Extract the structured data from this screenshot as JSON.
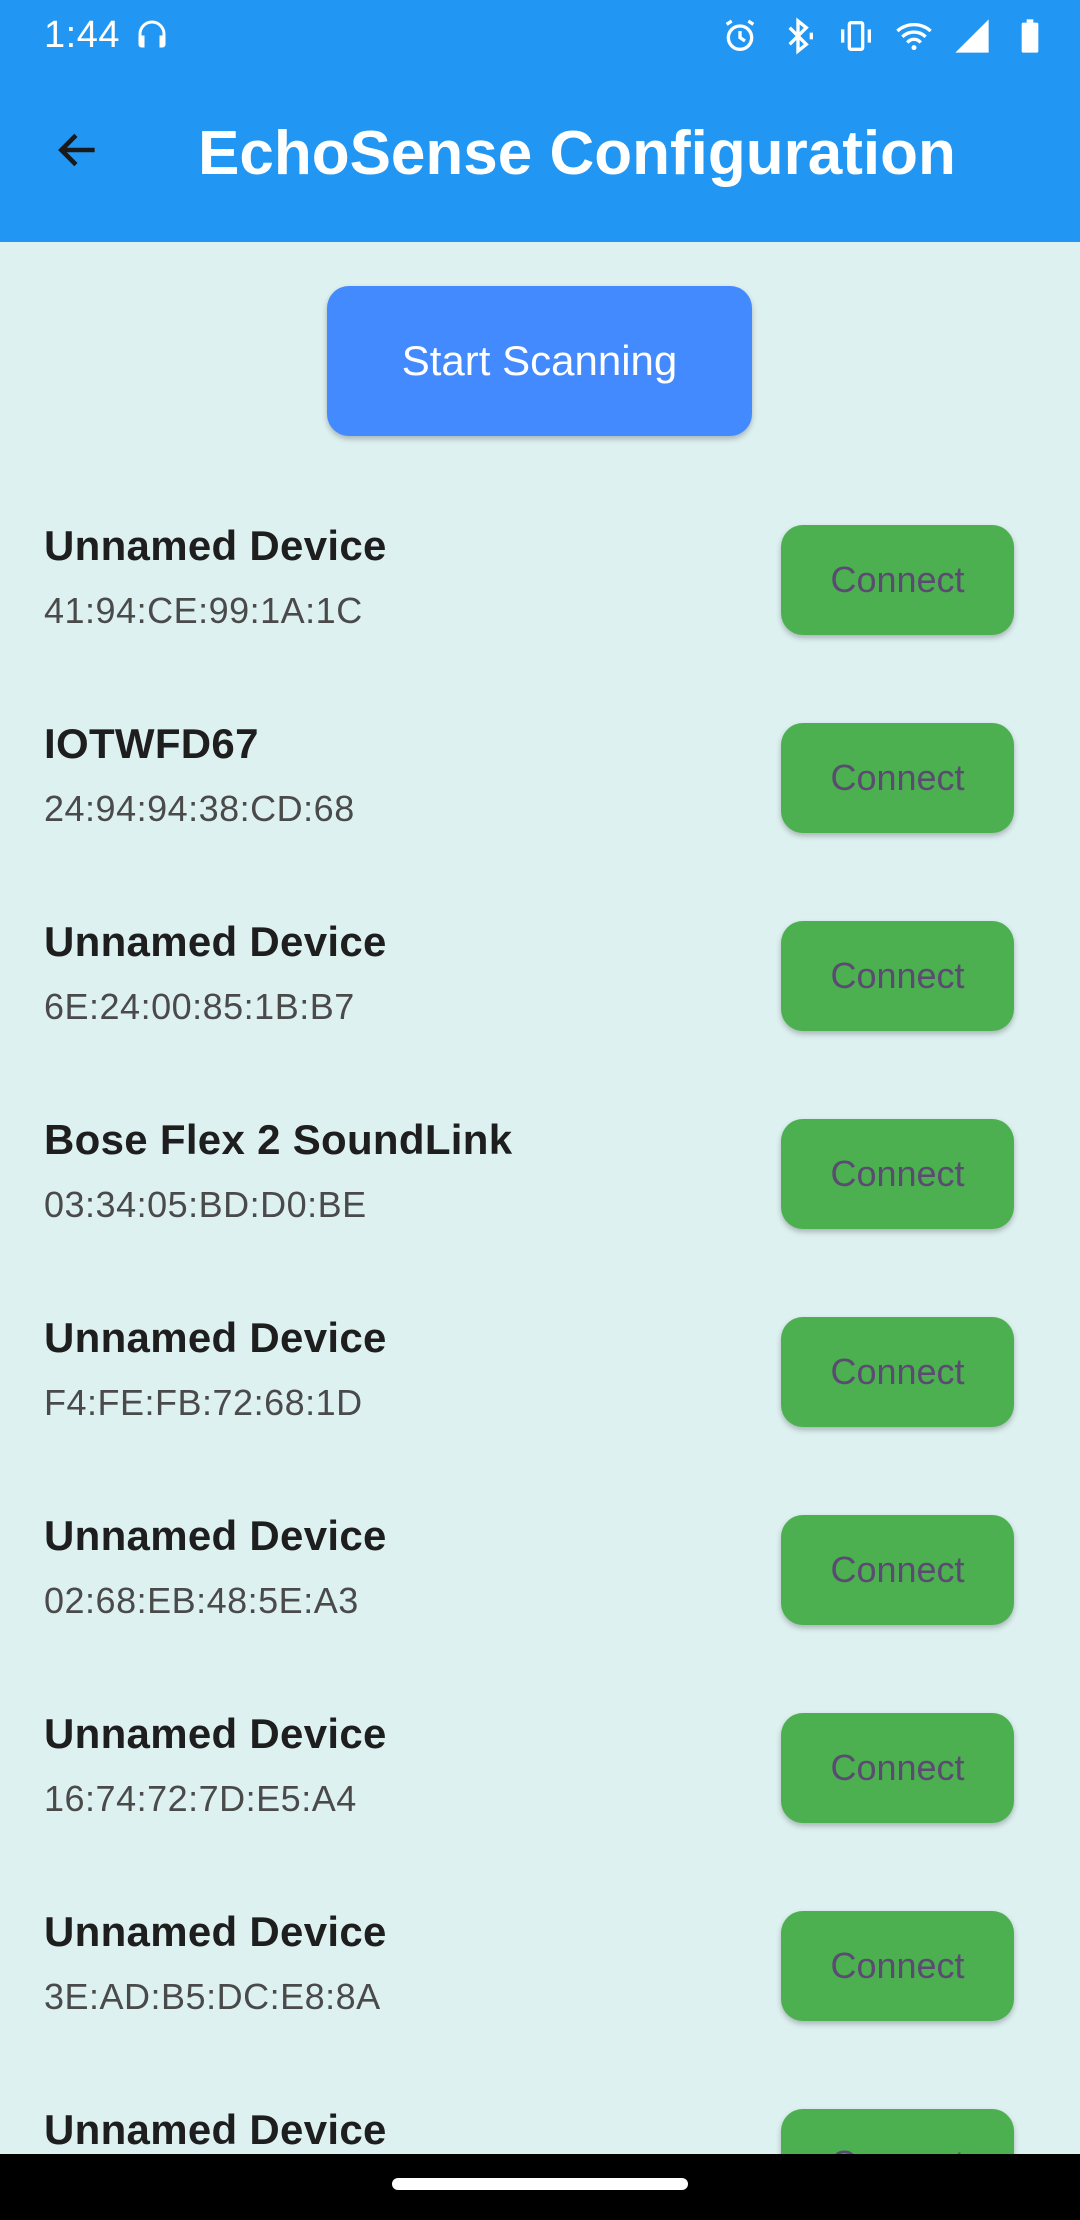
{
  "status_bar": {
    "time": "1:44",
    "icons": [
      "headphones-icon",
      "alarm-icon",
      "bluetooth-icon",
      "vibrate-icon",
      "wifi-icon",
      "signal-icon",
      "battery-icon"
    ]
  },
  "app_bar": {
    "title": "EchoSense Configuration",
    "back_icon": "arrow-back-icon"
  },
  "scan_button": {
    "label": "Start Scanning"
  },
  "devices": [
    {
      "name": "Unnamed Device",
      "mac": "41:94:CE:99:1A:1C",
      "action": "Connect"
    },
    {
      "name": "IOTWFD67",
      "mac": "24:94:94:38:CD:68",
      "action": "Connect"
    },
    {
      "name": "Unnamed Device",
      "mac": "6E:24:00:85:1B:B7",
      "action": "Connect"
    },
    {
      "name": "Bose Flex 2 SoundLink",
      "mac": "03:34:05:BD:D0:BE",
      "action": "Connect"
    },
    {
      "name": "Unnamed Device",
      "mac": "F4:FE:FB:72:68:1D",
      "action": "Connect"
    },
    {
      "name": "Unnamed Device",
      "mac": "02:68:EB:48:5E:A3",
      "action": "Connect"
    },
    {
      "name": "Unnamed Device",
      "mac": "16:74:72:7D:E5:A4",
      "action": "Connect"
    },
    {
      "name": "Unnamed Device",
      "mac": "3E:AD:B5:DC:E8:8A",
      "action": "Connect"
    },
    {
      "name": "Unnamed Device",
      "mac": "",
      "action": "Connect"
    }
  ],
  "colors": {
    "app_bar": "#2196f3",
    "background": "#def1f1",
    "scan_button": "#448aff",
    "connect_button": "#4caf50",
    "connect_text": "#5b4a72"
  }
}
